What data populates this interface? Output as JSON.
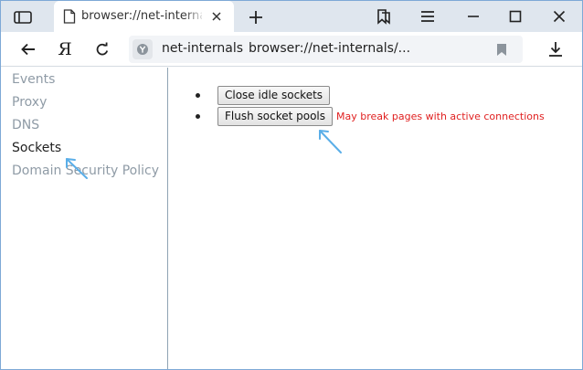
{
  "tab": {
    "title": "browser://net-internals/#"
  },
  "toolbar": {
    "yandex_letter": "Я",
    "omnibox_domain": "net-internals",
    "omnibox_url": "browser://net-internals/..."
  },
  "sidebar": {
    "items": [
      {
        "label": "Events"
      },
      {
        "label": "Proxy"
      },
      {
        "label": "DNS"
      },
      {
        "label": "Sockets"
      },
      {
        "label": "Domain Security Policy"
      }
    ],
    "selected": "Sockets"
  },
  "main": {
    "close_idle_label": "Close idle sockets",
    "flush_label": "Flush socket pools",
    "flush_warning": "May break pages with active connections"
  },
  "colors": {
    "accent": "#5aaee8",
    "warning": "#e02020",
    "tabstrip": "#dfe6ee"
  },
  "icons": [
    "tab-manager-icon",
    "page-icon",
    "close-icon",
    "plus-icon",
    "bookmarks-icon",
    "menu-icon",
    "minimize-icon",
    "maximize-icon",
    "back-arrow-icon",
    "reload-icon",
    "shield-icon",
    "bookmark-icon",
    "download-icon"
  ]
}
